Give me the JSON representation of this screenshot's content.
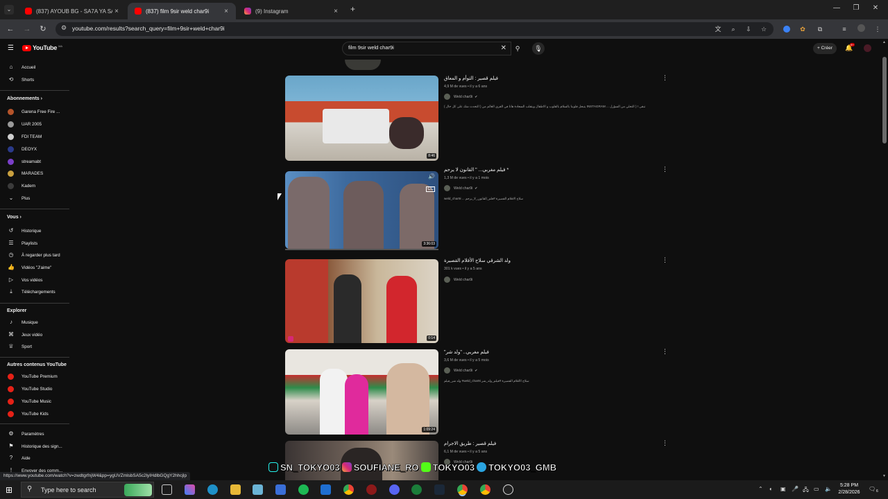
{
  "browser": {
    "tabs": [
      {
        "label": "(837) AYOUB BG - SA7A YA SA7",
        "active": false
      },
      {
        "label": "(837) film 9sir weld char9i",
        "active": true
      },
      {
        "label": "(9) Instagram",
        "active": false
      }
    ],
    "new_tab": "+",
    "url": "youtube.com/results?search_query=film+9sir+weld+char9i"
  },
  "youtube": {
    "logo_text": "YouTube",
    "logo_cc": "MA",
    "search_value": "film 9sir weld char9i",
    "create_label": "Créer",
    "notif_count": "9+"
  },
  "sidebar": {
    "main": [
      {
        "label": "Accueil",
        "icon": "home-icon"
      },
      {
        "label": "Shorts",
        "icon": "shorts-icon"
      }
    ],
    "subs_header": "Abonnements",
    "subs": [
      {
        "label": "Garena Free Fire ...",
        "color": "#b5542a"
      },
      {
        "label": "UAR 2005",
        "color": "#9a9a9a"
      },
      {
        "label": "FDI TEAM",
        "color": "#cfcfcf"
      },
      {
        "label": "DEOYX",
        "color": "#2a3a8a"
      },
      {
        "label": "streamabt",
        "color": "#7b3fc9"
      },
      {
        "label": "MARADES",
        "color": "#c9a03f"
      },
      {
        "label": "Kadem",
        "color": "#3b3b3b"
      }
    ],
    "more_label": "Plus",
    "you_header": "Vous",
    "you": [
      {
        "label": "Historique",
        "icon": "history-icon"
      },
      {
        "label": "Playlists",
        "icon": "playlists-icon"
      },
      {
        "label": "À regarder plus tard",
        "icon": "watch-later-icon"
      },
      {
        "label": "Vidéos \"J'aime\"",
        "icon": "like-icon"
      },
      {
        "label": "Vos vidéos",
        "icon": "your-videos-icon"
      },
      {
        "label": "Téléchargements",
        "icon": "downloads-icon"
      }
    ],
    "explore_header": "Explorer",
    "explore": [
      {
        "label": "Musique",
        "icon": "music-icon"
      },
      {
        "label": "Jeux vidéo",
        "icon": "gaming-icon"
      },
      {
        "label": "Sport",
        "icon": "sport-icon"
      }
    ],
    "other_header": "Autres contenus YouTube",
    "other": [
      {
        "label": "YouTube Premium"
      },
      {
        "label": "YouTube Studio"
      },
      {
        "label": "YouTube Music"
      },
      {
        "label": "YouTube Kids"
      }
    ],
    "bottom": [
      {
        "label": "Paramètres",
        "icon": "settings-icon"
      },
      {
        "label": "Historique des sign...",
        "icon": "report-history-icon"
      },
      {
        "label": "Aide",
        "icon": "help-icon"
      },
      {
        "label": "Envoyer des comm...",
        "icon": "feedback-icon"
      }
    ]
  },
  "results": [
    {
      "title": "فيلم قصير : التوأم و المعاق",
      "views": "4,9 M de vues",
      "age": "il y a 6 ans",
      "channel": "Weld char9i",
      "desc": "يتبحل قلوبنا بالسلام بالقلوب و الاطفال ويتقلب السعادة هانا في القرى العالم من ( التحدث شك على كل حال ) INSTAGRAM ... يتبقى ! ( التحلي من السؤرل",
      "duration": "8:46"
    },
    {
      "title": "* فيلم مغربي... \" القانون لا يرحم",
      "views": "1,3 M de vues",
      "age": "il y a 1 mois",
      "channel": "Weld char9i",
      "desc": "weld_char9i ... سلاح الافلام القصيرة #فلم_القانون_لا_يرحم",
      "duration": "3:36:03"
    },
    {
      "title": "ولد الشرقي سلاح الأفلام القصيرة",
      "views": "301 k vues",
      "age": "il y a 5 ans",
      "channel": "Weld char9i",
      "desc": "",
      "duration": "0:14"
    },
    {
      "title": "فيلم مغربي.. \"ولد شر\"",
      "views": "3,6 M de vues",
      "age": "il y a 5 mois",
      "channel": "Weld char9i",
      "desc": "ولد شر_فيلم #weld_char9i سلاح الأفلام القصيرة #فيلم_ولد_شر",
      "duration": "1:09:24"
    },
    {
      "title": "فيلم قصير : طريق الاجرام",
      "views": "6,1 M de vues",
      "age": "il y a 5 ans",
      "channel": "Weld char9i",
      "desc": "",
      "duration": ""
    }
  ],
  "status_url": "https://www.youtube.com/watch?v=zwdtgrfnjW4&pp=ygUVZmlsbSA5c2lyIHdlbGQgY2hhcjlp",
  "overlay": {
    "part1": "SN_TOKYO03",
    "part2": "SOUFIANE_RO",
    "part3": "TOKYO03",
    "part4": "TOKYO03_GMB"
  },
  "taskbar": {
    "search_placeholder": "Type here to search",
    "time": "5:28 PM",
    "date": "2/28/2026",
    "notif_count": "6"
  }
}
